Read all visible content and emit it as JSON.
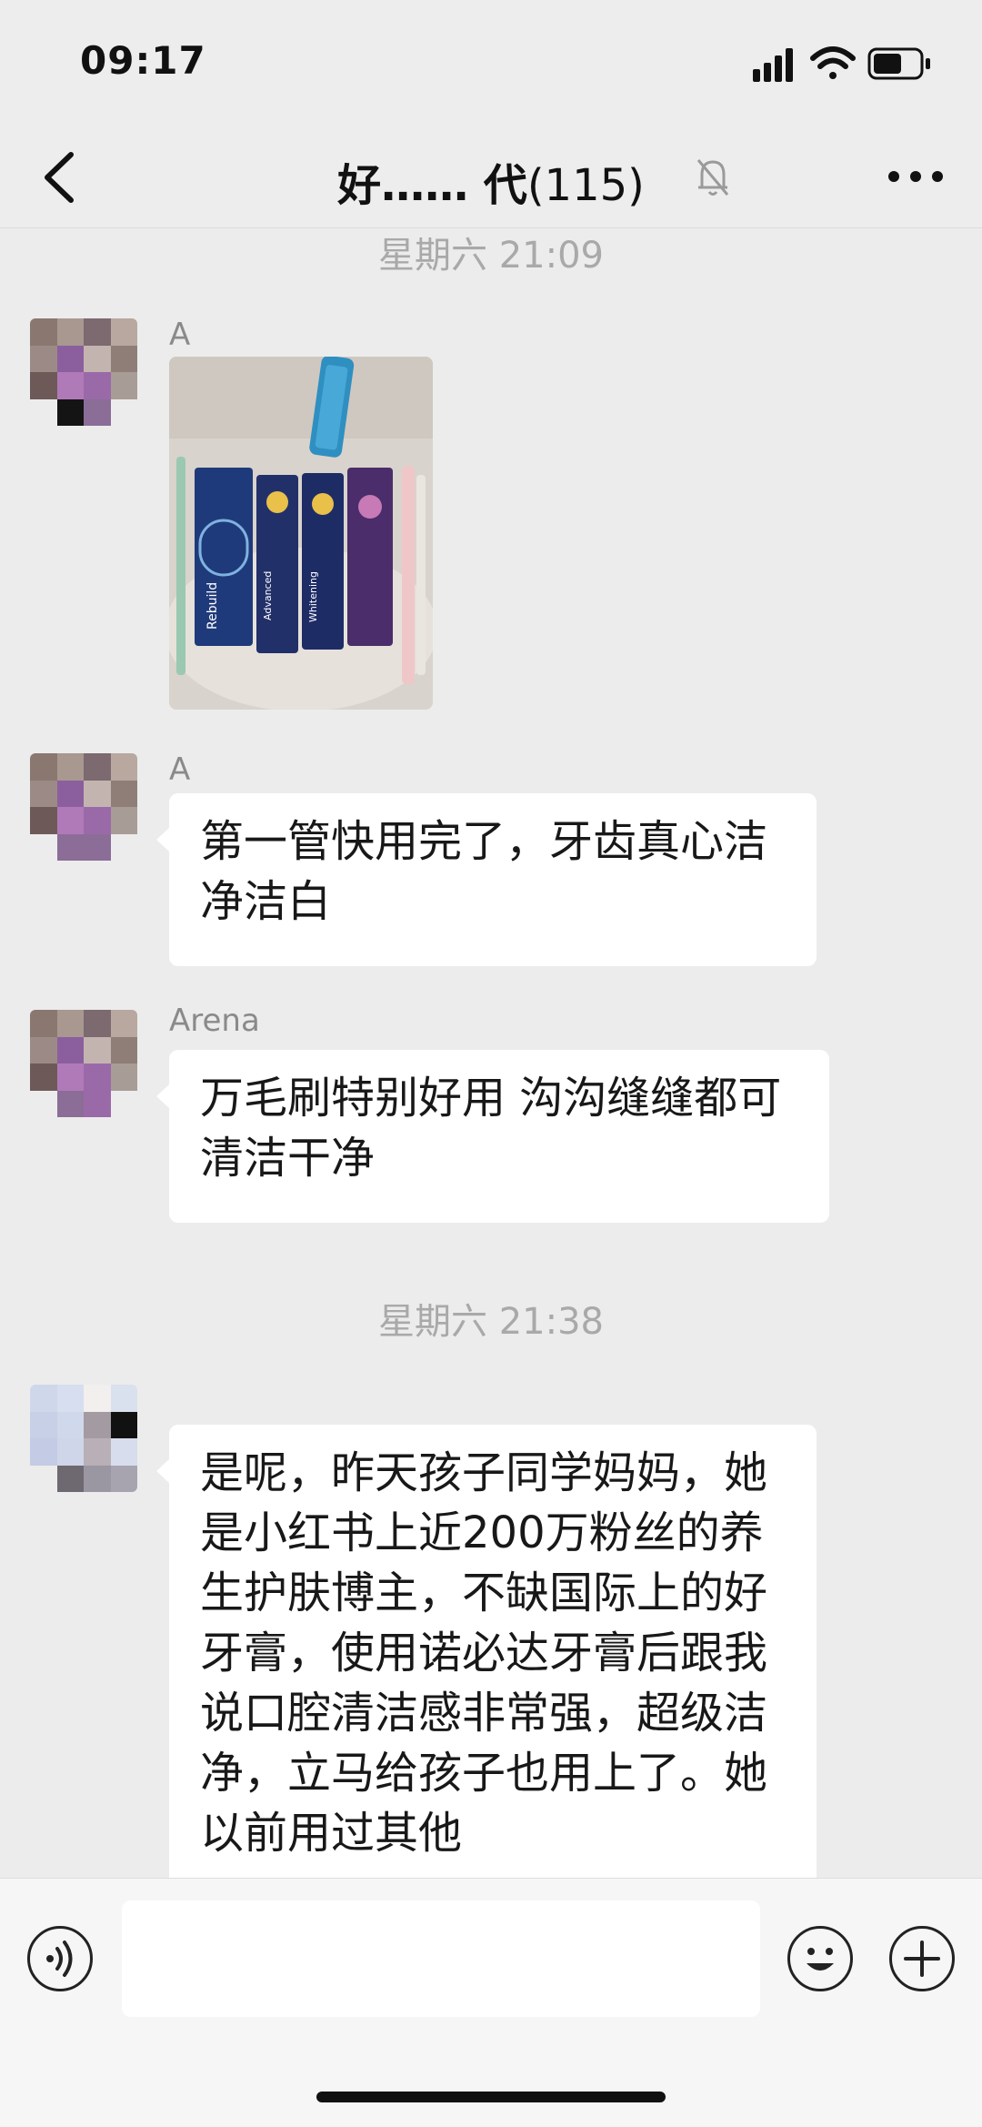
{
  "status_bar": {
    "time": "09:17"
  },
  "header": {
    "title": "好…… 代",
    "member_count": "(115)"
  },
  "messages": [
    {
      "type": "timestamp",
      "text": "星期六 21:09"
    },
    {
      "type": "image",
      "sender": "A"
    },
    {
      "type": "text",
      "sender": "A",
      "text": "第一管快用完了，牙齿真心洁净洁白"
    },
    {
      "type": "text",
      "sender": "Arena",
      "text": "万毛刷特别好用 沟沟缝缝都可清洁干净"
    },
    {
      "type": "timestamp",
      "text": "星期六 21:38"
    },
    {
      "type": "text",
      "sender": "",
      "text": "是呢，昨天孩子同学妈妈，她是小红书上近200万粉丝的养生护肤博主，不缺国际上的好牙膏，使用诺必达牙膏后跟我说口腔清洁感非常强，超级洁净，立马给孩子也用上了。她以前用过其他"
    }
  ],
  "photo": {
    "brand": "Rebuild",
    "product_texts": [
      "Advanced",
      "Whitening"
    ]
  },
  "input_bar": {
    "text": ""
  },
  "icons": [
    "back-icon",
    "mute-bell-icon",
    "more-icon",
    "voice-icon",
    "emoji-icon",
    "plus-icon",
    "signal-icon",
    "wifi-icon",
    "battery-icon"
  ]
}
